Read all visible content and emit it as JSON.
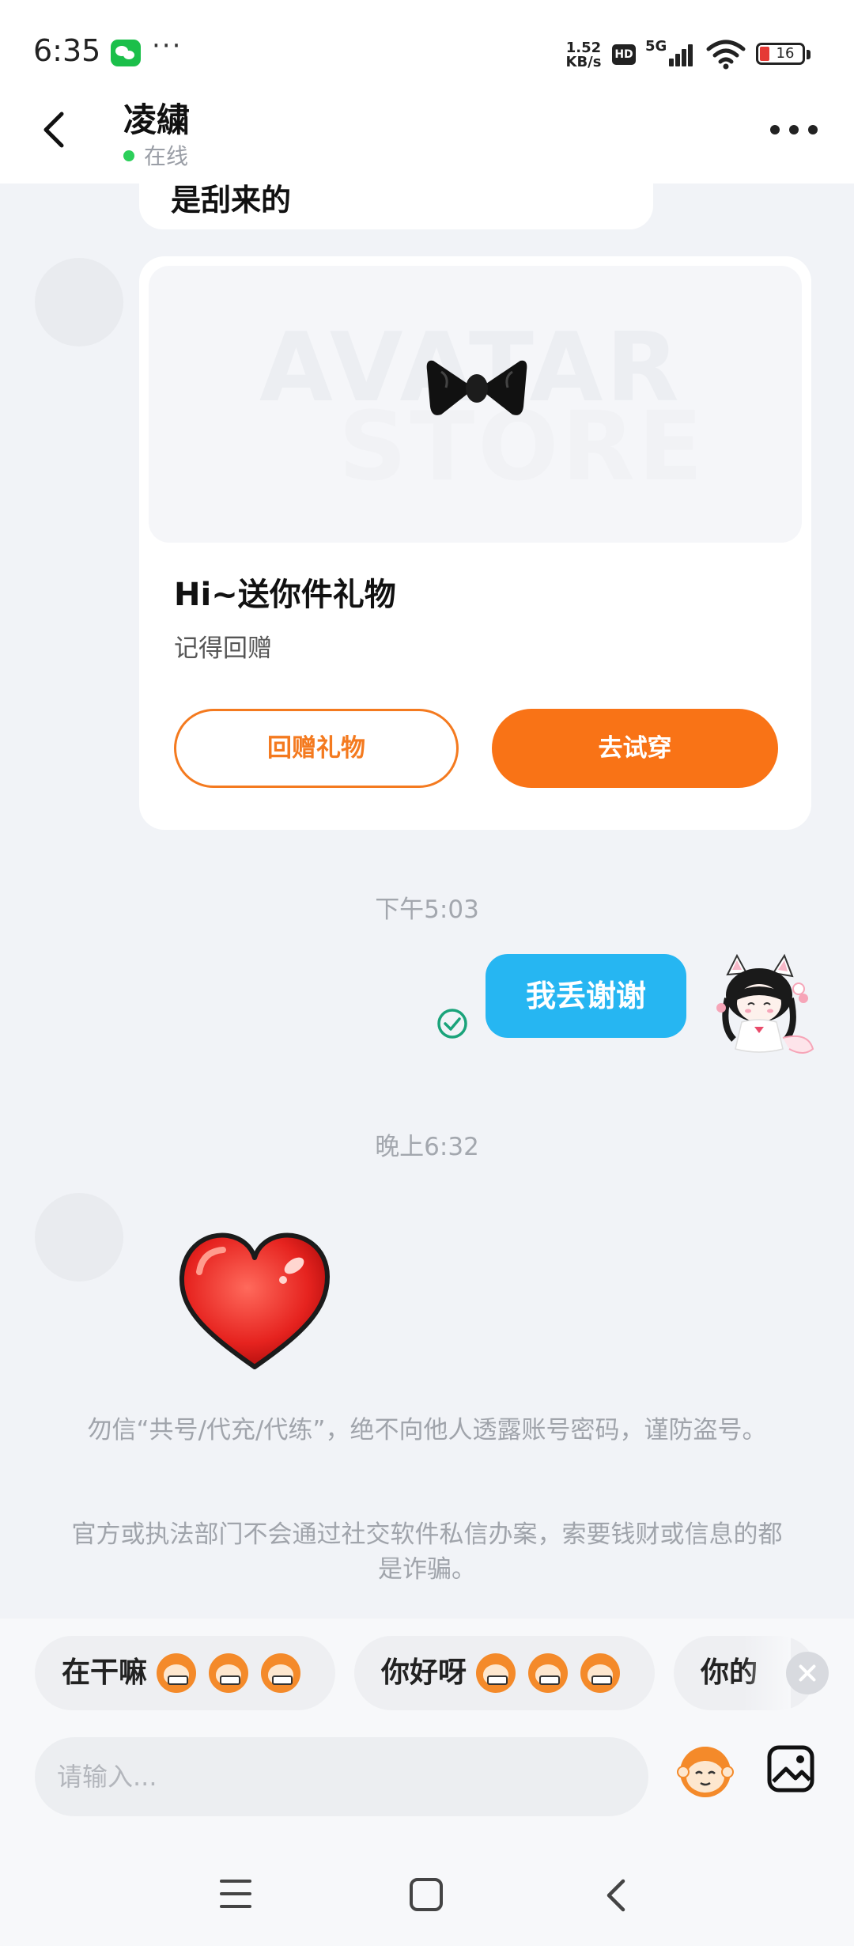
{
  "status_bar": {
    "time": "6:35",
    "more": "···",
    "net_speed_top": "1.52",
    "net_speed_bottom": "KB/s",
    "hd_label": "HD",
    "network": "5G",
    "battery_level": "16",
    "notification_icon": "wechat-icon"
  },
  "header": {
    "back_icon": "chevron-left-icon",
    "contact_name": "凌繍",
    "presence": "在线",
    "presence_color": "#2ccf5a",
    "menu_icon": "more-horizontal-icon"
  },
  "messages": {
    "partial_text": "是刮来的",
    "gift_card": {
      "watermark_top": "AVATAR",
      "watermark_bottom": "STORE",
      "gift_icon": "bow-tie-icon",
      "title": "Hi~送你件礼物",
      "subtitle": "记得回赠",
      "return_button": "回赠礼物",
      "try_on_button": "去试穿",
      "accent_color": "#f97316"
    },
    "timestamp_1": "下午5:03",
    "sent_text": "我丢谢谢",
    "sent_bubble_color": "#26b6f2",
    "timestamp_2": "晚上6:32",
    "received_sticker": "heart-sticker"
  },
  "notices": {
    "notice_1": "勿信“共号/代充/代练”，绝不向他人透露账号密码，谨防盗号。",
    "notice_2": "官方或执法部门不会通过社交软件私信办案，索要钱财或信息的都是诈骗。"
  },
  "quick_replies": [
    {
      "label": "在干嘛",
      "emoji": "grinning-monkey-emoji"
    },
    {
      "label": "你好呀",
      "emoji": "glasses-monkey-emoji"
    },
    {
      "label": "你的",
      "emoji": ""
    }
  ],
  "input": {
    "placeholder": "请输入..."
  },
  "nav": {
    "menu_icon": "menu-icon",
    "home_icon": "home-icon",
    "back_icon": "back-icon"
  }
}
